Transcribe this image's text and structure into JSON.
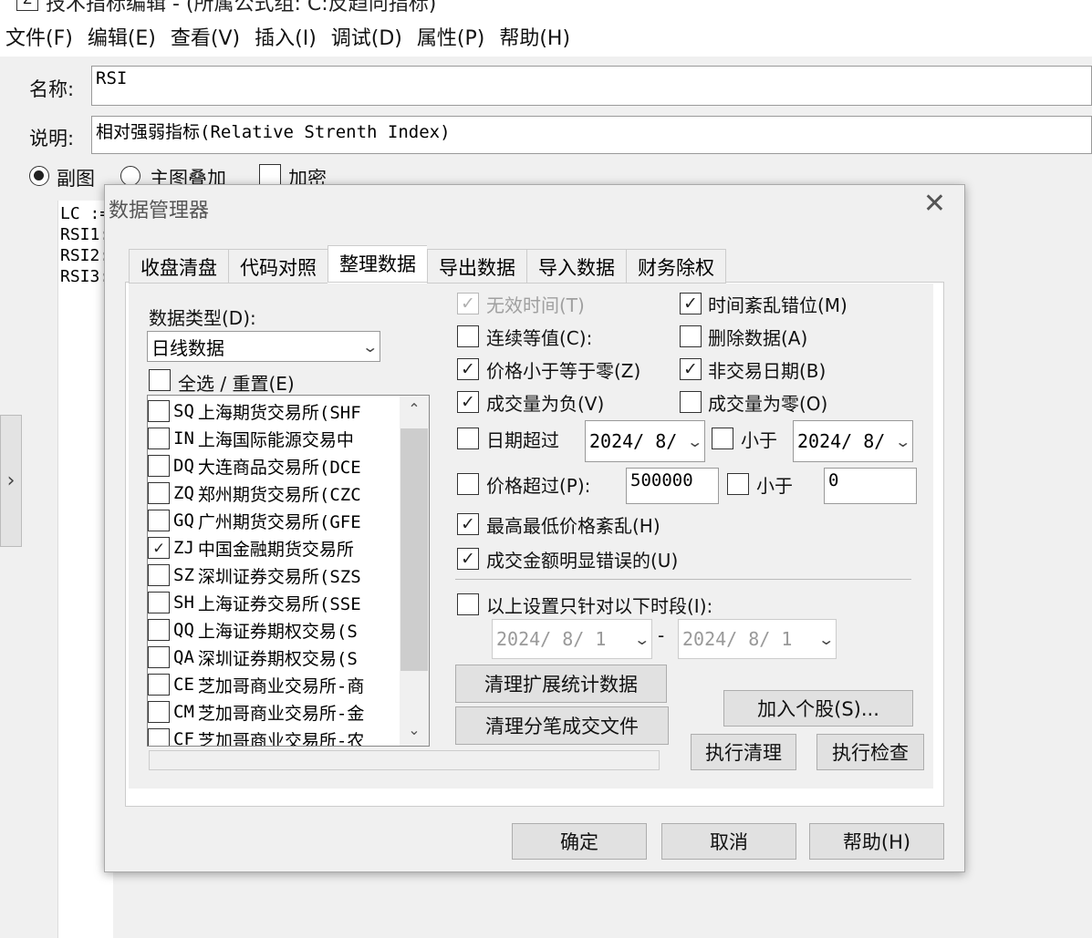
{
  "window": {
    "title": "技术指标编辑 - (所属公式组: C:反趋向指标)",
    "app_icon": "Z"
  },
  "menu": {
    "items": [
      "文件(F)",
      "编辑(E)",
      "查看(V)",
      "插入(I)",
      "调试(D)",
      "属性(P)",
      "帮助(H)"
    ]
  },
  "editor": {
    "name_label": "名称:",
    "name_value": "RSI",
    "desc_label": "说明:",
    "desc_value": "相对强弱指标(Relative Strenth Index)",
    "radio_sub": "副图",
    "radio_main": "主图叠加",
    "encrypt_label": "加密",
    "code_lines": [
      "LC :=",
      "RSI1:",
      "RSI2:",
      "RSI3:"
    ],
    "side_tab_glyph": "›"
  },
  "dialog": {
    "title": "数据管理器",
    "close_glyph": "✕",
    "tabs": [
      "收盘清盘",
      "代码对照",
      "整理数据",
      "导出数据",
      "导入数据",
      "财务除权"
    ],
    "active_tab": "整理数据",
    "data_type_label": "数据类型(D):",
    "data_type_value": "日线数据",
    "select_all_label": "全选 / 重置(E)",
    "exchanges": [
      {
        "code": "SQ",
        "name": "上海期货交易所(SHF",
        "checked": false
      },
      {
        "code": "IN",
        "name": "上海国际能源交易中",
        "checked": false
      },
      {
        "code": "DQ",
        "name": "大连商品交易所(DCE",
        "checked": false
      },
      {
        "code": "ZQ",
        "name": "郑州期货交易所(CZC",
        "checked": false
      },
      {
        "code": "GQ",
        "name": "广州期货交易所(GFE",
        "checked": false
      },
      {
        "code": "ZJ",
        "name": "中国金融期货交易所",
        "checked": true
      },
      {
        "code": "SZ",
        "name": "深圳证券交易所(SZS",
        "checked": false
      },
      {
        "code": "SH",
        "name": "上海证券交易所(SSE",
        "checked": false
      },
      {
        "code": "QQ",
        "name": "上海证券期权交易(S",
        "checked": false
      },
      {
        "code": "QA",
        "name": "深圳证券期权交易(S",
        "checked": false
      },
      {
        "code": "CE",
        "name": "芝加哥商业交易所-商",
        "checked": false
      },
      {
        "code": "CM",
        "name": "芝加哥商业交易所-金",
        "checked": false
      },
      {
        "code": "CF",
        "name": "芝加哥商业交易所-农",
        "checked": false
      }
    ],
    "options": {
      "invalid_time": "无效时间(T)",
      "time_disorder": "时间紊乱错位(M)",
      "continuous_equal": "连续等值(C):",
      "delete_data": "删除数据(A)",
      "price_le_zero": "价格小于等于零(Z)",
      "non_trading_day": "非交易日期(B)",
      "volume_negative": "成交量为负(V)",
      "volume_zero": "成交量为零(O)",
      "date_exceed": "日期超过",
      "date_exceed_value": "2024/ 8/",
      "less_than": "小于",
      "date_less_value": "2024/ 8/",
      "price_exceed": "价格超过(P):",
      "price_exceed_value": "500000",
      "price_less_value": "0",
      "high_low_disorder": "最高最低价格紊乱(H)",
      "amount_error": "成交金额明显错误的(U)",
      "period_only": "以上设置只针对以下时段(I):",
      "period_from": "2024/ 8/ 1",
      "period_dash": "-",
      "period_to": "2024/ 8/ 1"
    },
    "buttons": {
      "clear_ext": "清理扩展统计数据",
      "clear_tick": "清理分笔成交文件",
      "add_stock": "加入个股(S)...",
      "run_clean": "执行清理",
      "run_check": "执行检查",
      "ok": "确定",
      "cancel": "取消",
      "help": "帮助(H)"
    },
    "check_glyph": "✓",
    "chevron_glyph": "⌄",
    "scroll_up": "⌃",
    "scroll_down": "⌄"
  }
}
